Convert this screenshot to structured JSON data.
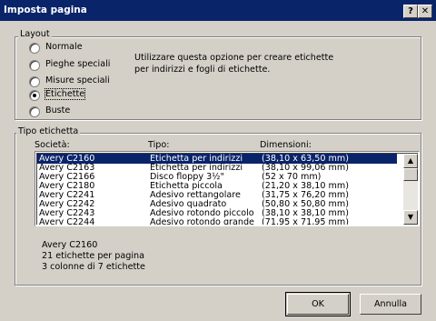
{
  "window": {
    "title": "Imposta pagina",
    "help_button": "?",
    "close_button": "✕"
  },
  "layout_group": {
    "label": "Layout",
    "options": [
      {
        "label": "Normale",
        "selected": false
      },
      {
        "label": "Pieghe speciali",
        "selected": false
      },
      {
        "label": "Misure speciali",
        "selected": false
      },
      {
        "label": "Etichette",
        "selected": true
      },
      {
        "label": "Buste",
        "selected": false
      }
    ],
    "description": "Utilizzare questa opzione per creare etichette per indirizzi e fogli di etichette."
  },
  "label_type_group": {
    "label": "Tipo etichetta",
    "columns": [
      "Società:",
      "Tipo:",
      "Dimensioni:"
    ],
    "rows": [
      [
        "Avery C2160",
        "Etichetta per indirizzi",
        "(38,10 x 63,50 mm)"
      ],
      [
        "Avery C2163",
        "Etichetta per indirizzi",
        "(38,10 x 99,06 mm)"
      ],
      [
        "Avery C2166",
        "Disco floppy 3½\"",
        "(52 x 70 mm)"
      ],
      [
        "Avery C2180",
        "Etichetta piccola",
        "(21,20 x 38,10 mm)"
      ],
      [
        "Avery C2241",
        "Adesivo rettangolare",
        "(31,75 x 76,20 mm)"
      ],
      [
        "Avery C2242",
        "Adesivo quadrato",
        "(50,80 x 50,80 mm)"
      ],
      [
        "Avery C2243",
        "Adesivo rotondo piccolo",
        "(38,10 x 38,10 mm)"
      ],
      [
        "Avery C2244",
        "Adesivo rotondo grande",
        "(71,95 x 71,95 mm)"
      ]
    ],
    "selected_index": 0,
    "summary": {
      "name": "Avery C2160",
      "per_page": "21 etichette per pagina",
      "layout": "3 colonne di 7 etichette"
    }
  },
  "buttons": {
    "ok": "OK",
    "cancel": "Annulla"
  },
  "scroll": {
    "up": "▲",
    "down": "▼"
  }
}
